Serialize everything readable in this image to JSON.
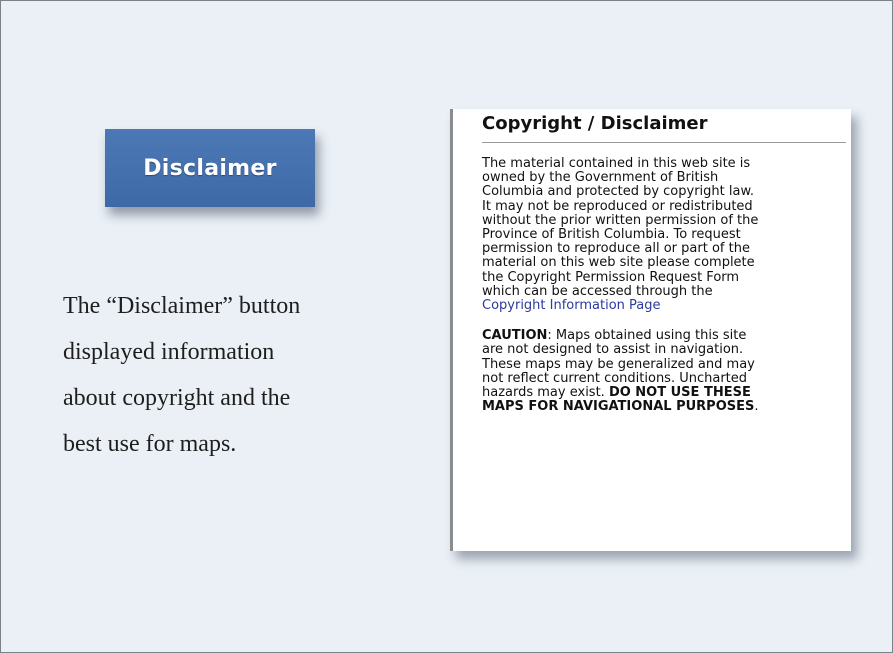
{
  "button": {
    "label": "Disclaimer"
  },
  "caption": {
    "lines": [
      "The “Disclaimer” button",
      "displayed information",
      "about copyright and the",
      "best use for maps."
    ]
  },
  "panel": {
    "title": "Copyright / Disclaimer",
    "paragraph1_lines": [
      "The material contained in this web site is",
      "owned by the Government of British",
      "Columbia and protected by copyright law.",
      "It may not be reproduced or redistributed",
      "without the prior written permission of the",
      "Province of British Columbia. To request",
      "permission to reproduce all or part of the",
      "material on this web site please complete",
      "the Copyright Permission Request Form",
      "which can be accessed through the"
    ],
    "link_text": "Copyright Information Page",
    "caution_label": "CAUTION",
    "caution_line1_rest": ": Maps obtained using this site",
    "caution_lines": [
      "are not designed to assist in navigation.",
      "These maps may be generalized and may",
      "not reflect current conditions. Uncharted"
    ],
    "hazard_prefix": "hazards may exist. ",
    "warning_line1": "DO NOT USE THESE",
    "warning_line2": "MAPS FOR NAVIGATIONAL PURPOSES",
    "warning_end": "."
  },
  "colors": {
    "background": "#eaf0f6",
    "button": "#4470ad",
    "link": "#2a3a9e"
  }
}
